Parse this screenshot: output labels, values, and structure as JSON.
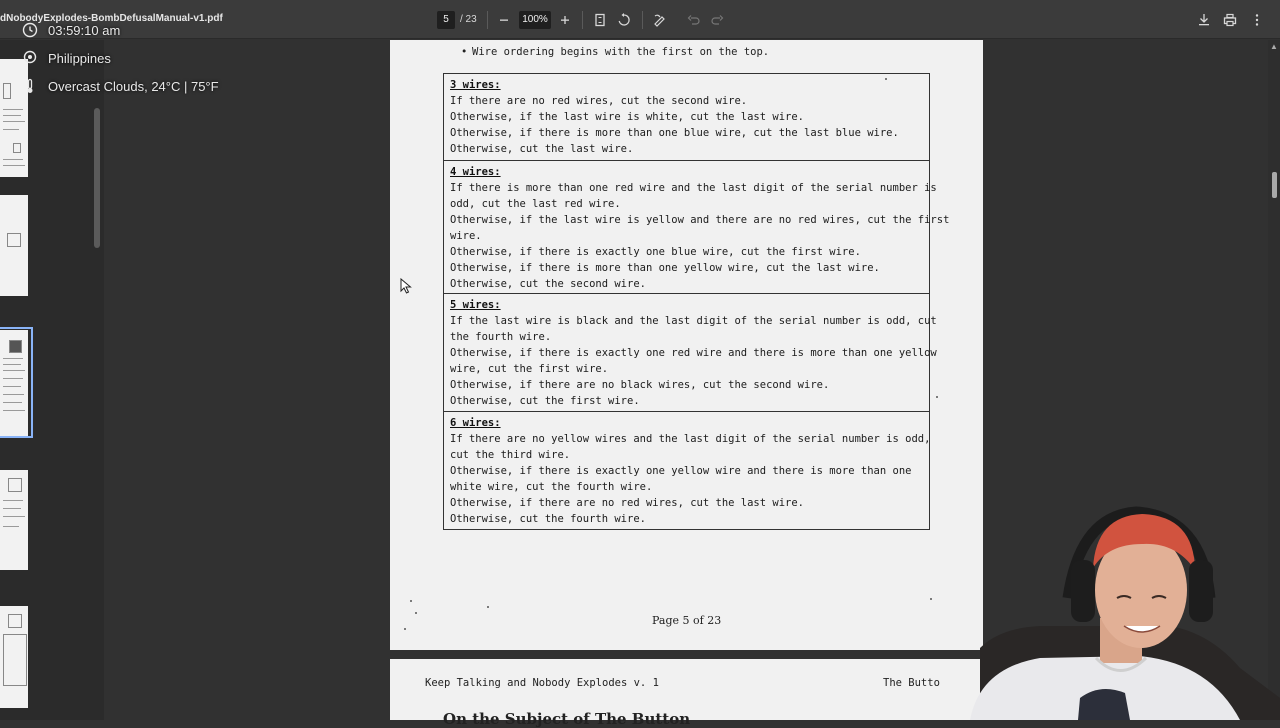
{
  "toolbar": {
    "doc_title": "dNobodyExplodes-BombDefusalManual-v1.pdf",
    "current_page": "5",
    "total_pages": "/ 23",
    "zoom": "100%",
    "icons": [
      "minus-icon",
      "plus-icon",
      "fit-page-icon",
      "rotate-icon",
      "annotate-icon",
      "undo-icon",
      "redo-icon",
      "download-icon",
      "print-icon",
      "more-icon"
    ]
  },
  "overlay": {
    "time": "03:59:10 am",
    "location": "Philippines",
    "weather": "Overcast Clouds, 24°C | 75°F"
  },
  "page": {
    "bullet": "Wire ordering begins with the first on the top.",
    "sections": [
      {
        "heading": "3 wires:",
        "lines": [
          "If there are no red wires, cut the second wire.",
          "Otherwise, if the last wire is white, cut the last wire.",
          "Otherwise, if there is more than one blue wire, cut the last blue wire.",
          "Otherwise, cut the last wire."
        ]
      },
      {
        "heading": "4 wires:",
        "lines": [
          "If there is more than one red wire and the last digit of the serial number is",
          "odd, cut the last red wire.",
          "Otherwise, if the last wire is yellow and there are no red wires, cut the first",
          "wire.",
          "Otherwise, if there is exactly one blue wire, cut the first wire.",
          "Otherwise, if there is more than one yellow wire, cut the last wire.",
          "Otherwise, cut the second wire."
        ]
      },
      {
        "heading": "5 wires:",
        "lines": [
          "If the last wire is black and the last digit of the serial number is odd, cut",
          "the fourth wire.",
          "Otherwise, if there is exactly one red wire and there is more than one yellow",
          "wire, cut the first wire.",
          "Otherwise, if there are no black wires, cut the second wire.",
          "Otherwise, cut the first wire."
        ]
      },
      {
        "heading": "6 wires:",
        "lines": [
          "If there are no yellow wires and the last digit of the serial number is odd,",
          "cut the third wire.",
          "Otherwise, if there is exactly one yellow wire and there is more than one",
          "white wire, cut the fourth wire.",
          "Otherwise, if there are no red wires, cut the last wire.",
          "Otherwise, cut the fourth wire."
        ]
      }
    ],
    "footer": "Page 5 of 23"
  },
  "next_page": {
    "header_left": "Keep Talking and Nobody Explodes v. 1",
    "header_right": "The Butto",
    "title": "On the Subject of The Button"
  }
}
